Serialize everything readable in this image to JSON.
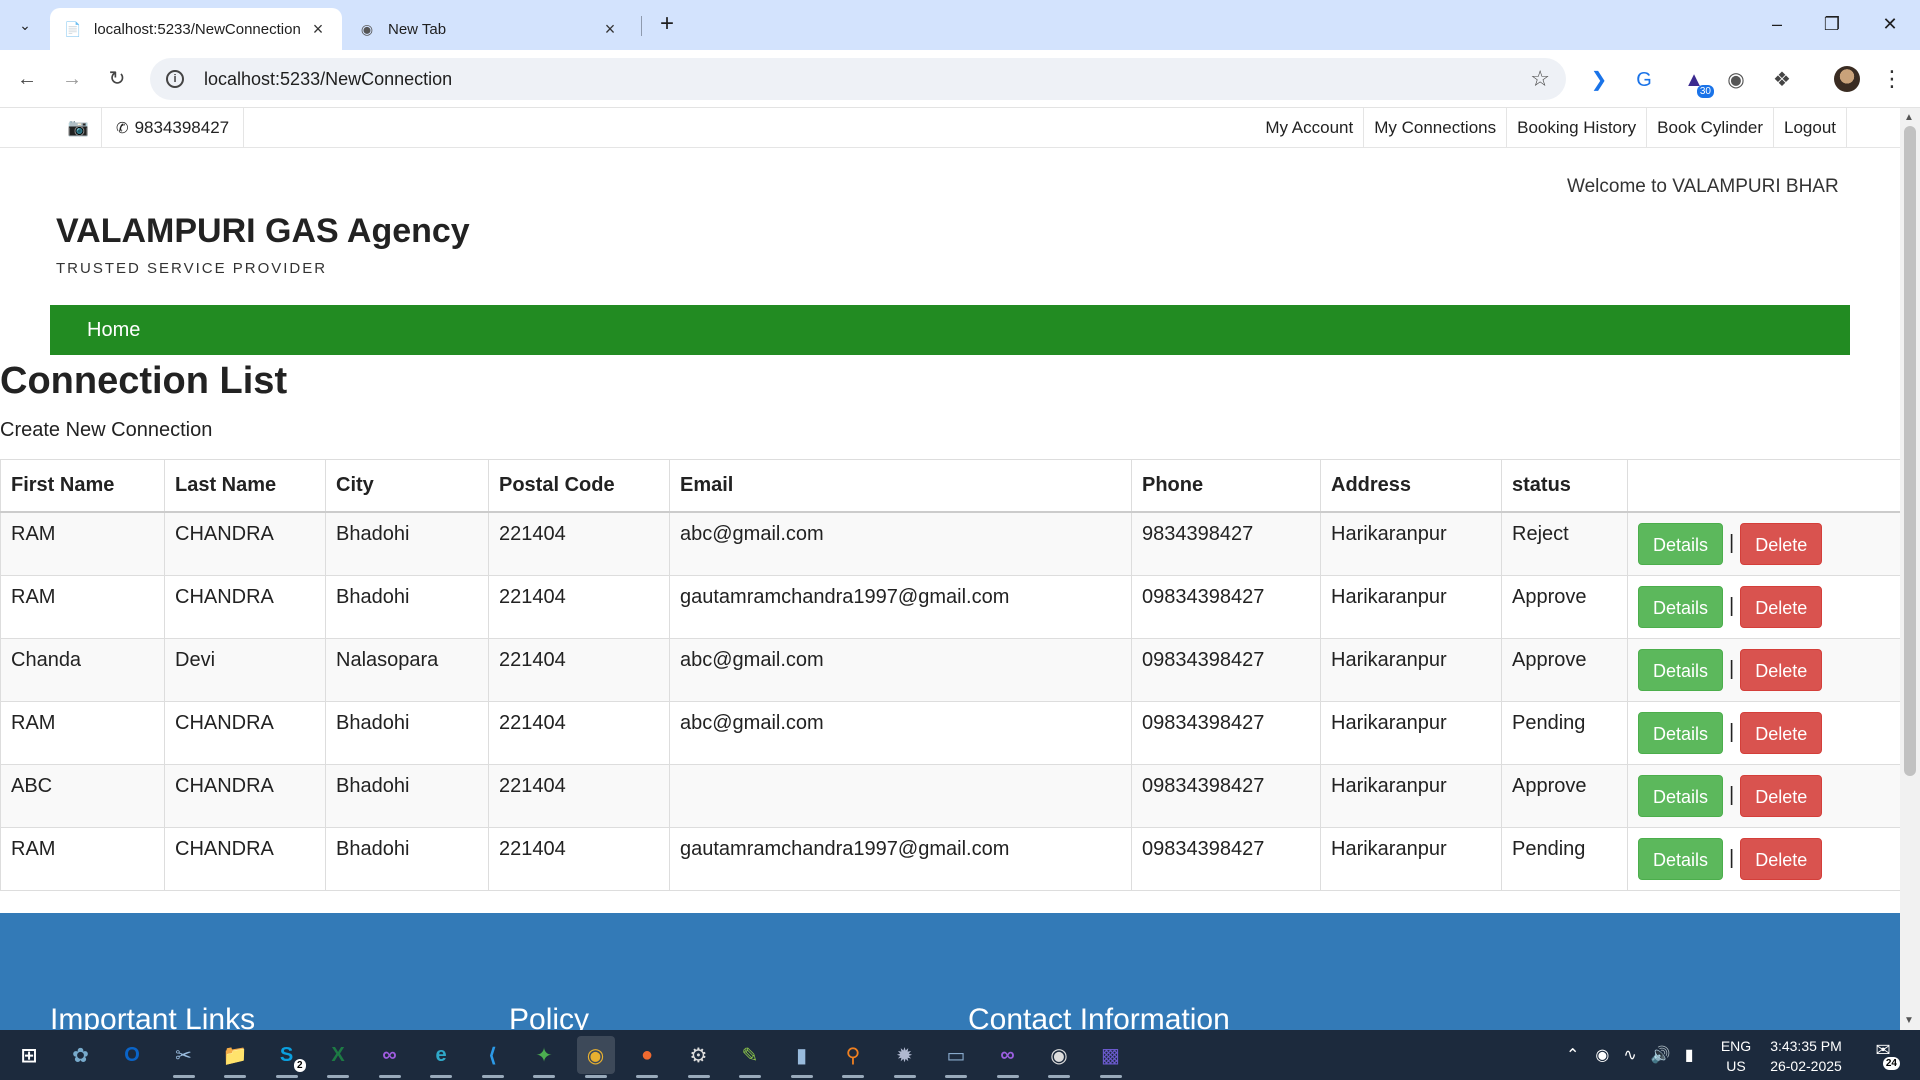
{
  "browser": {
    "tabs": [
      {
        "title": "localhost:5233/NewConnection",
        "active": true
      },
      {
        "title": "New Tab",
        "active": false
      }
    ],
    "url": "localhost:5233/NewConnection",
    "extensions": [
      {
        "icon": "reading-mode-icon"
      },
      {
        "icon": "translate-icon"
      },
      {
        "icon": "academic-cap-icon",
        "badge": "30"
      },
      {
        "icon": "privacy-shield-icon"
      },
      {
        "icon": "puzzle-icon"
      }
    ]
  },
  "site": {
    "topbar": {
      "phone": "9834398427",
      "nav": [
        "My Account",
        "My Connections",
        "Booking History",
        "Book Cylinder",
        "Logout"
      ]
    },
    "marquee": "Welcome to VALAMPURI BHAR",
    "brand": "VALAMPURI GAS Agency",
    "tagline": "TRUSTED SERVICE PROVIDER",
    "mainnav": {
      "home": "Home"
    },
    "page_title": "Connection List",
    "create_link": "Create New Connection",
    "table": {
      "headers": [
        "First Name",
        "Last Name",
        "City",
        "Postal Code",
        "Email",
        "Phone",
        "Address",
        "status",
        ""
      ],
      "details_label": "Details",
      "delete_label": "Delete",
      "separator": "|",
      "rows": [
        [
          "RAM",
          "CHANDRA",
          "Bhadohi",
          "221404",
          "abc@gmail.com",
          "9834398427",
          "Harikaranpur",
          "Reject"
        ],
        [
          "RAM",
          "CHANDRA",
          "Bhadohi",
          "221404",
          "gautamramchandra1997@gmail.com",
          "09834398427",
          "Harikaranpur",
          "Approve"
        ],
        [
          "Chanda",
          "Devi",
          "Nalasopara",
          "221404",
          "abc@gmail.com",
          "09834398427",
          "Harikaranpur",
          "Approve"
        ],
        [
          "RAM",
          "CHANDRA",
          "Bhadohi",
          "221404",
          "abc@gmail.com",
          "09834398427",
          "Harikaranpur",
          "Pending"
        ],
        [
          "ABC",
          "CHANDRA",
          "Bhadohi",
          "221404",
          "",
          "09834398427",
          "Harikaranpur",
          "Approve"
        ],
        [
          "RAM",
          "CHANDRA",
          "Bhadohi",
          "221404",
          "gautamramchandra1997@gmail.com",
          "09834398427",
          "Harikaranpur",
          "Pending"
        ]
      ]
    },
    "footer": {
      "headings": [
        "Important Links",
        "Policy",
        "Contact Information"
      ]
    },
    "colors": {
      "nav_green": "#228b22",
      "footer_blue": "#337ab7",
      "details_green": "#5cb85c",
      "delete_red": "#d9534f"
    }
  },
  "taskbar": {
    "apps": [
      "start-icon",
      "copilot-icon",
      "outlook-icon",
      "snipping-icon",
      "file-explorer-icon",
      "skype-icon",
      "excel-icon",
      "visual-studio-icon",
      "edge-icon",
      "vscode-icon",
      "mongodb-icon",
      "chrome-icon",
      "postman-icon",
      "settings-icon",
      "notepad-icon",
      "sticky-icon",
      "search-app-icon",
      "compass-icon",
      "folder-app-icon",
      "vs-purple-icon",
      "obs-icon",
      "terminal-icon"
    ],
    "badge_skype": "2",
    "language": {
      "line1": "ENG",
      "line2": "US"
    },
    "time": "3:43:35 PM",
    "date": "26-02-2025",
    "notifications": "24"
  }
}
